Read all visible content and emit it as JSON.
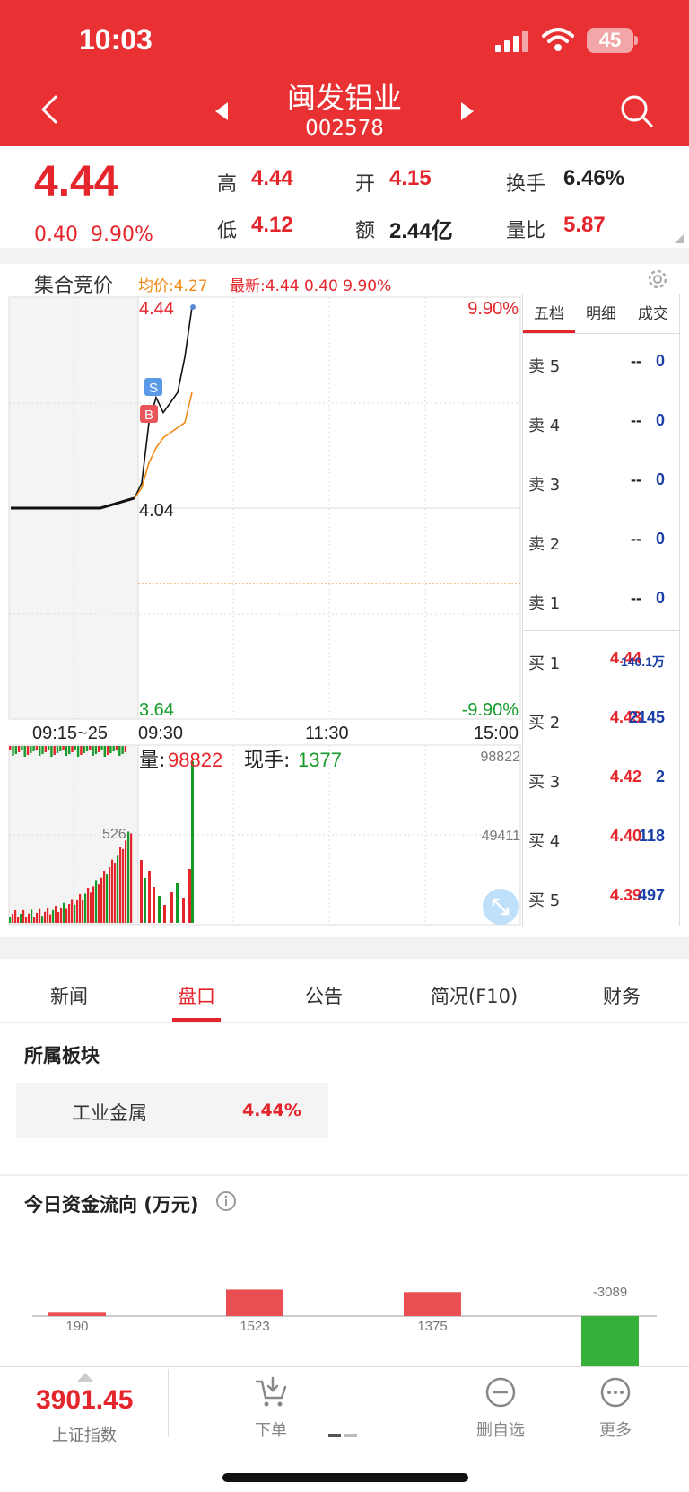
{
  "status": {
    "time": "10:03",
    "battery": "45"
  },
  "header": {
    "name": "闽发铝业",
    "code": "002578"
  },
  "quote": {
    "price": "4.44",
    "change": "0.40",
    "change_pct": "9.90%",
    "high_label": "高",
    "high": "4.44",
    "open_label": "开",
    "open": "4.15",
    "turnover_label": "换手",
    "turnover": "6.46%",
    "low_label": "低",
    "low": "4.12",
    "amount_label": "额",
    "amount": "2.44亿",
    "vol_ratio_label": "量比",
    "vol_ratio": "5.87"
  },
  "chart": {
    "title": "集合竞价",
    "avg_label": "均价:4.27",
    "latest_label": "最新:4.44 0.40 9.90%",
    "price_top": "4.44",
    "price_mid": "4.04",
    "price_bottom": "3.64",
    "pct_top": "9.90%",
    "pct_bottom": "-9.90%",
    "time_labels": [
      "09:15~25",
      "09:30",
      "11:30",
      "15:00"
    ],
    "vol_label": "量:",
    "vol_value": "98822",
    "cur_label": "现手:",
    "cur_value": "1377",
    "vol_top": "98822",
    "vol_mid": "49411",
    "auction_vol": "526",
    "marker_s": "S",
    "marker_b": "B"
  },
  "chart_data": {
    "type": "line",
    "title": "",
    "xlabel": "",
    "ylabel": "",
    "ylim": [
      3.64,
      4.44
    ],
    "x": [
      "09:15",
      "09:20",
      "09:25",
      "09:30",
      "09:31",
      "09:32",
      "09:33",
      "09:34",
      "09:35",
      "09:36",
      "09:37",
      "09:38"
    ],
    "series": [
      {
        "name": "",
        "values": [
          4.04,
          4.04,
          4.04,
          4.06,
          4.09,
          4.21,
          4.26,
          4.23,
          4.25,
          4.27,
          4.34,
          4.44
        ]
      },
      {
        "name": "均价",
        "values": [
          null,
          null,
          null,
          4.06,
          4.08,
          4.13,
          4.16,
          4.18,
          4.19,
          4.2,
          4.21,
          4.27
        ]
      }
    ],
    "reference": 4.04,
    "volume_ylim": [
      0,
      98822
    ]
  },
  "orderbook": {
    "tabs": [
      "五档",
      "明细",
      "成交"
    ],
    "sell": [
      {
        "label": "卖 5",
        "price": "--",
        "vol": "0"
      },
      {
        "label": "卖 4",
        "price": "--",
        "vol": "0"
      },
      {
        "label": "卖 3",
        "price": "--",
        "vol": "0"
      },
      {
        "label": "卖 2",
        "price": "--",
        "vol": "0"
      },
      {
        "label": "卖 1",
        "price": "--",
        "vol": "0"
      }
    ],
    "buy": [
      {
        "label": "买 1",
        "price": "4.44",
        "vol": "140.1万"
      },
      {
        "label": "买 2",
        "price": "4.43",
        "vol": "2145"
      },
      {
        "label": "买 3",
        "price": "4.42",
        "vol": "2"
      },
      {
        "label": "买 4",
        "price": "4.40",
        "vol": "118"
      },
      {
        "label": "买 5",
        "price": "4.39",
        "vol": "497"
      }
    ]
  },
  "tabs": [
    "新闻",
    "盘口",
    "公告",
    "简况(F10)",
    "财务"
  ],
  "sector": {
    "title": "所属板块",
    "name": "工业金属",
    "pct": "4.44%"
  },
  "flow": {
    "title": "今日资金流向 (万元)",
    "values": [
      190,
      1523,
      1375,
      -3089
    ],
    "labels": [
      "190",
      "1523",
      "1375",
      "-3089"
    ],
    "colors": [
      "#e94f52",
      "#e94f52",
      "#e94f52",
      "#37b03a"
    ]
  },
  "bottom": {
    "index_value": "3901.45",
    "index_name": "上证指数",
    "btn1": "下单",
    "btn2": "删自选",
    "btn3": "更多"
  },
  "icons": {
    "back": "back-chevron-icon",
    "search": "search-icon",
    "gear": "gear-icon",
    "expand": "expand-icon",
    "info": "info-icon"
  }
}
